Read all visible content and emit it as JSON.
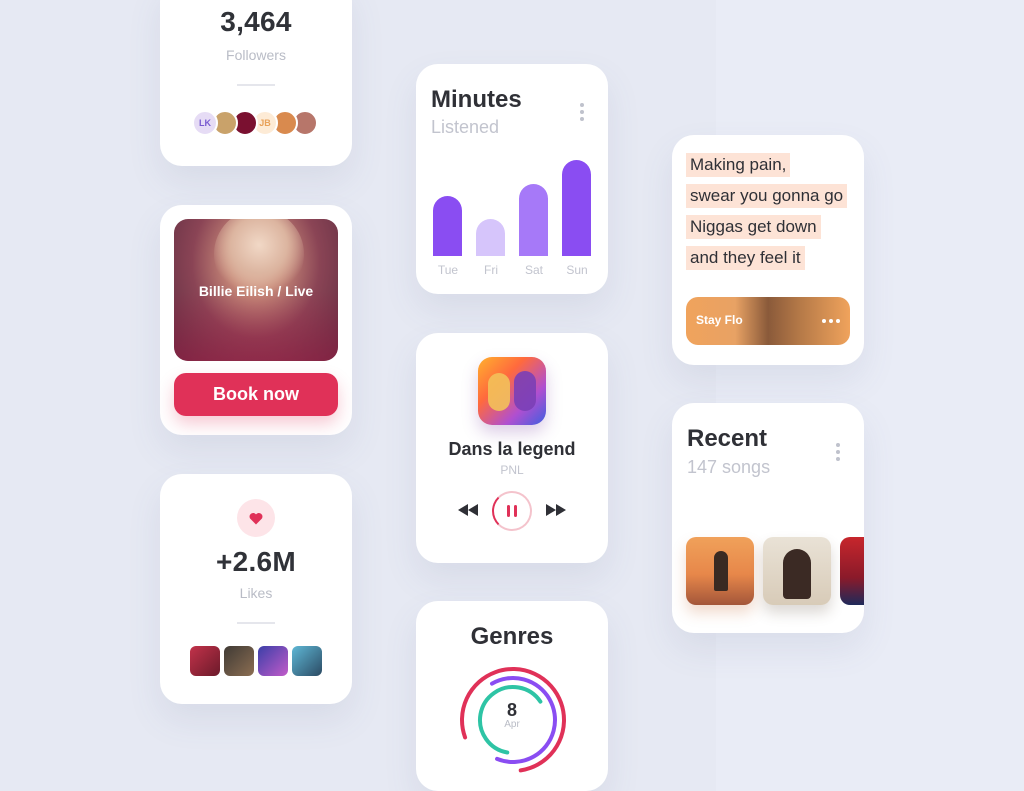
{
  "followers": {
    "count": "3,464",
    "label": "Followers",
    "avatars": [
      {
        "initials": "LK",
        "bg": "#e6dcf5",
        "fg": "#7a5bd0"
      },
      {
        "initials": "",
        "bg": "#c9a26a",
        "fg": "#fff"
      },
      {
        "initials": "",
        "bg": "#7a1030",
        "fg": "#fff"
      },
      {
        "initials": "JB",
        "bg": "#fdebd6",
        "fg": "#e8a25a"
      },
      {
        "initials": "",
        "bg": "#d98a4e",
        "fg": "#fff"
      },
      {
        "initials": "",
        "bg": "#b7766a",
        "fg": "#fff"
      }
    ]
  },
  "event": {
    "title": "Billie Eilish / Live",
    "button_label": "Book now"
  },
  "likes": {
    "count": "+2.6M",
    "label": "Likes"
  },
  "minutes": {
    "title": "Minutes",
    "subtitle": "Listened",
    "days": [
      {
        "label": "Tue",
        "value": 60,
        "color": "#8a4df2"
      },
      {
        "label": "Fri",
        "value": 37,
        "color": "#d6c5fb"
      },
      {
        "label": "Sat",
        "value": 72,
        "color": "#a679f8"
      },
      {
        "label": "Sun",
        "value": 96,
        "color": "#8a4df2"
      }
    ]
  },
  "player": {
    "track": "Dans la legend",
    "artist": "PNL"
  },
  "genres": {
    "title": "Genres",
    "day": "8",
    "month": "Apr"
  },
  "lyrics": {
    "lines": [
      "Making pain,",
      "swear you gonna go",
      "Niggas get down",
      "and they feel it"
    ],
    "track_pill": "Stay Flo"
  },
  "recent": {
    "title": "Recent",
    "subtitle": "147 songs"
  }
}
